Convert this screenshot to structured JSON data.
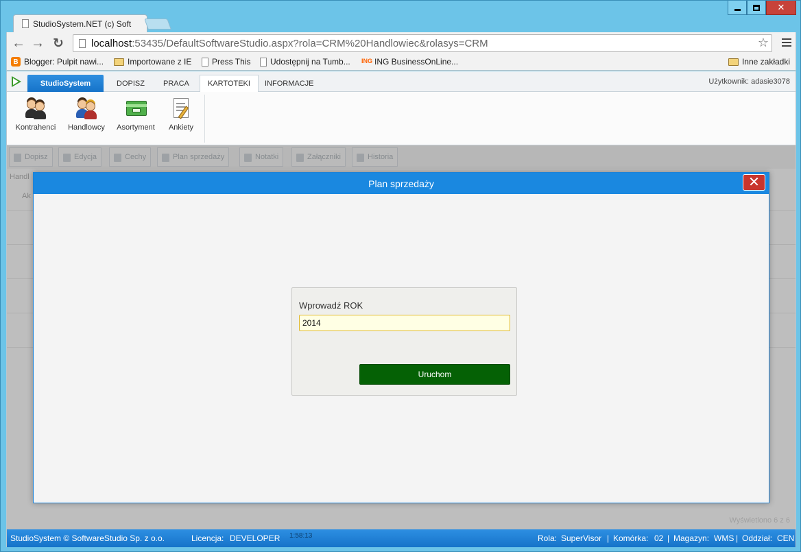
{
  "browser": {
    "tab_title": "StudioSystem.NET (c) Soft",
    "url_host": "localhost",
    "url_rest": ":53435/DefaultSoftwareStudio.aspx?rola=CRM%20Handlowiec&rolasys=CRM",
    "bookmarks": [
      {
        "label": "Blogger: Pulpit nawi...",
        "icon": "blogger-icon"
      },
      {
        "label": "Importowane z IE",
        "icon": "folder-icon"
      },
      {
        "label": "Press This",
        "icon": "page-icon"
      },
      {
        "label": "Udostępnij na Tumb...",
        "icon": "page-icon"
      },
      {
        "label": "ING BusinessOnLine...",
        "icon": "ing-icon"
      }
    ],
    "other_bookmarks": "Inne zakładki"
  },
  "app": {
    "brand": "StudioSystem",
    "menu_tabs": [
      "DOPISZ",
      "PRACA",
      "KARTOTEKI",
      "INFORMACJE"
    ],
    "active_tab": "KARTOTEKI",
    "user": "Użytkownik: adasie3078",
    "ribbon": [
      {
        "label": "Kontrahenci",
        "icon": "contractors-icon"
      },
      {
        "label": "Handlowcy",
        "icon": "salespeople-icon"
      },
      {
        "label": "Asortyment",
        "icon": "assortment-icon"
      },
      {
        "label": "Ankiety",
        "icon": "surveys-icon"
      }
    ],
    "subtoolbar": [
      "Dopisz",
      "Edycja",
      "Cechy",
      "Plan sprzedaży",
      "Notatki",
      "Załączniki",
      "Historia"
    ],
    "grid_header": "Handl",
    "grid_sub": "Ak",
    "pager": "Wyświetlono 6 z 6"
  },
  "dialog": {
    "title": "Plan sprzedaży",
    "label": "Wprowadź ROK",
    "year_value": "2014",
    "run_label": "Uruchom"
  },
  "statusbar": {
    "copyright": "StudioSystem © SoftwareStudio Sp. z o.o.",
    "license_label": "Licencja:",
    "license_value": "DEVELOPER",
    "time": "1:58:13",
    "role_label": "Rola:",
    "role_value": "SuperVisor",
    "cell_label": "Komórka:",
    "cell_value": "02",
    "warehouse_label": "Magazyn:",
    "warehouse_value": "WMS",
    "branch_label": "Oddział:",
    "branch_value": "CEN"
  },
  "colors": {
    "accent": "#1a88e0",
    "run_button": "#056105",
    "close_button": "#c9352d",
    "license": "#f4a36a"
  }
}
